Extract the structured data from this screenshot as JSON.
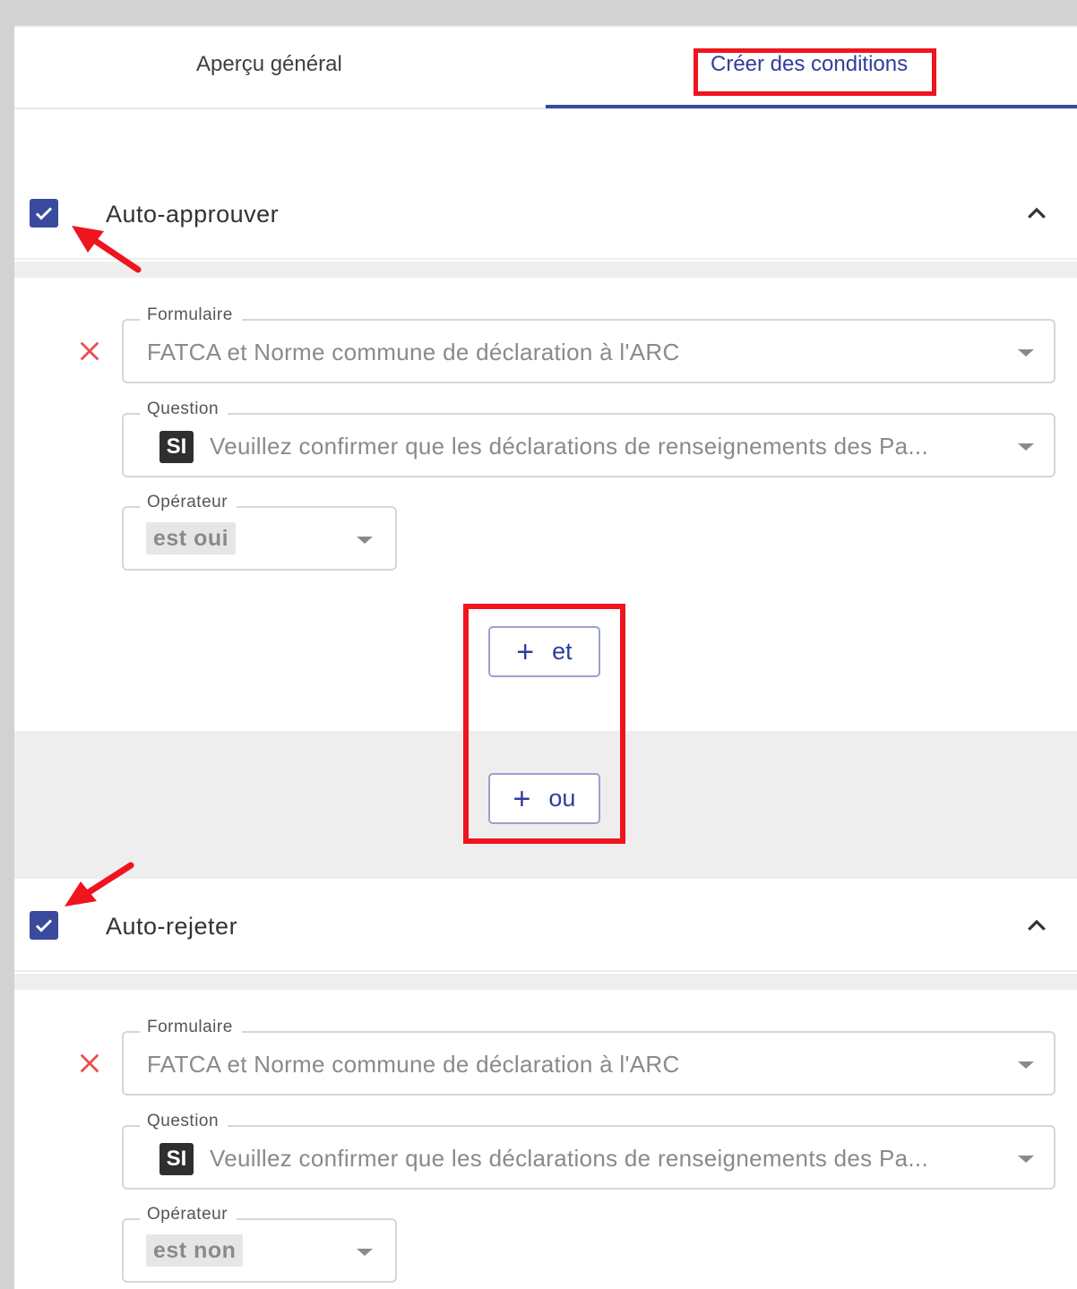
{
  "tabs": [
    {
      "label": "Aperçu général",
      "active": false
    },
    {
      "label": "Créer des conditions",
      "active": true
    }
  ],
  "sections": [
    {
      "title": "Auto-approuver",
      "checked": true,
      "condition": {
        "form": {
          "label": "Formulaire",
          "value": "FATCA et Norme commune de déclaration à l'ARC"
        },
        "question": {
          "label": "Question",
          "badge": "SI",
          "value": "Veuillez confirmer que les déclarations de renseignements des Pa..."
        },
        "operator": {
          "label": "Opérateur",
          "value": "est oui"
        }
      },
      "and_button": "et",
      "or_button": "ou"
    },
    {
      "title": "Auto-rejeter",
      "checked": true,
      "condition": {
        "form": {
          "label": "Formulaire",
          "value": "FATCA et Norme commune de déclaration à l'ARC"
        },
        "question": {
          "label": "Question",
          "badge": "SI",
          "value": "Veuillez confirmer que les déclarations de renseignements des Pa..."
        },
        "operator": {
          "label": "Opérateur",
          "value": "est non"
        }
      }
    }
  ],
  "icons": {
    "checkbox": "check-icon",
    "collapse": "chevron-up-icon",
    "remove": "close-icon",
    "add": "plus-icon",
    "dropdown": "caret-down-icon"
  },
  "colors": {
    "accent": "#3a4a9f",
    "highlight": "#f0141e",
    "remove": "#e8504f"
  }
}
